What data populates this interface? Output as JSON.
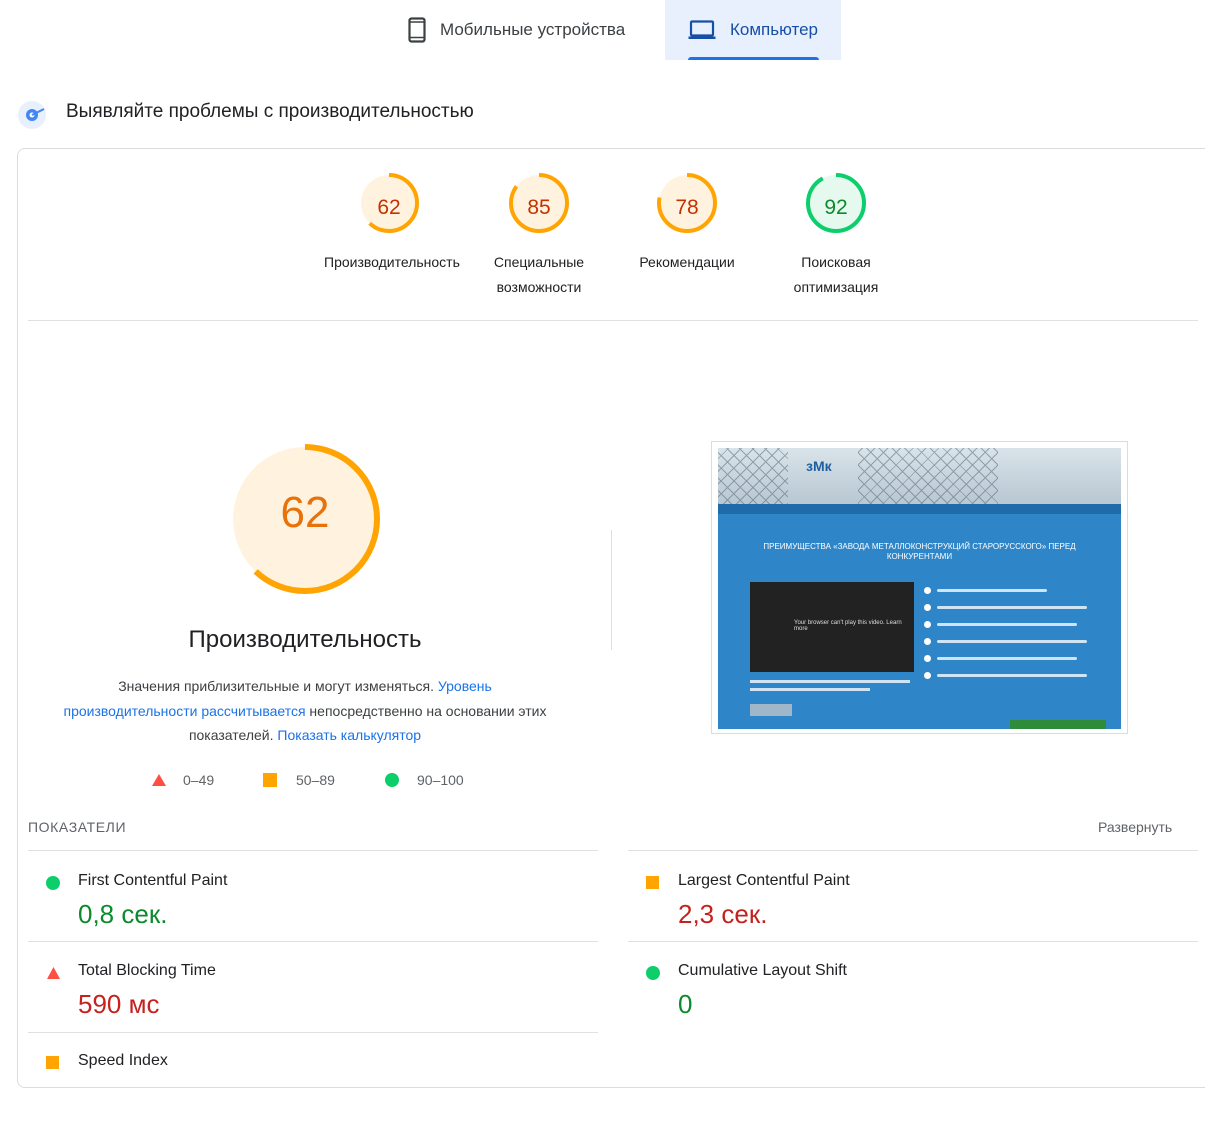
{
  "tabs": {
    "mobile": {
      "label": "Мобильные устройства",
      "icon": "smartphone-icon"
    },
    "desktop": {
      "label": "Компьютер",
      "icon": "laptop-icon",
      "selected": true
    }
  },
  "section": {
    "title": "Выявляйте проблемы с производительностью",
    "icon": "lighthouse-icon"
  },
  "summary_scores": [
    {
      "value": "62",
      "label_line1": "Производительность",
      "label_line2": "",
      "score": 62,
      "color": "#e8710a"
    },
    {
      "value": "85",
      "label_line1": "Специальные",
      "label_line2": "возможности",
      "score": 85,
      "color": "#e8710a"
    },
    {
      "value": "78",
      "label_line1": "Рекомендации",
      "label_line2": "",
      "score": 78,
      "color": "#e8710a"
    },
    {
      "value": "92",
      "label_line1": "Поисковая",
      "label_line2": "оптимизация",
      "score": 92,
      "color": "#0cce6b"
    }
  ],
  "performance": {
    "score": "62",
    "score_value": 62,
    "title": "Производительность",
    "desc_text1": "Значения приблизительные и могут изменяться. ",
    "desc_link1": "Уровень производительности рассчитывается",
    "desc_text2": " непосредственно на основании этих показателей. ",
    "desc_link2": "Показать калькулятор"
  },
  "legend": [
    {
      "range": "0–49",
      "shape": "triangle",
      "color": "#ff4e42"
    },
    {
      "range": "50–89",
      "shape": "square",
      "color": "#ffa400"
    },
    {
      "range": "90–100",
      "shape": "circle",
      "color": "#0cce6b"
    }
  ],
  "screenshot": {
    "logo": "зМк",
    "heading": "ПРЕИМУЩЕСТВА «ЗАВОДА МЕТАЛЛОКОНСТРУКЦИЙ СТАРОРУССКОГО» ПЕРЕД КОНКУРЕНТАМИ",
    "video_message": "Your browser can't play this video. Learn more"
  },
  "metrics": {
    "label": "ПОКАЗАТЕЛИ",
    "expand": "Развернуть",
    "items": [
      {
        "name": "First Contentful Paint",
        "value": "0,8 сек.",
        "status": "good"
      },
      {
        "name": "Largest Contentful Paint",
        "value": "2,3 сек.",
        "status": "average"
      },
      {
        "name": "Total Blocking Time",
        "value": "590 мс",
        "status": "poor"
      },
      {
        "name": "Cumulative Layout Shift",
        "value": "0",
        "status": "good"
      },
      {
        "name": "Speed Index",
        "value": "",
        "status": "average"
      }
    ]
  }
}
